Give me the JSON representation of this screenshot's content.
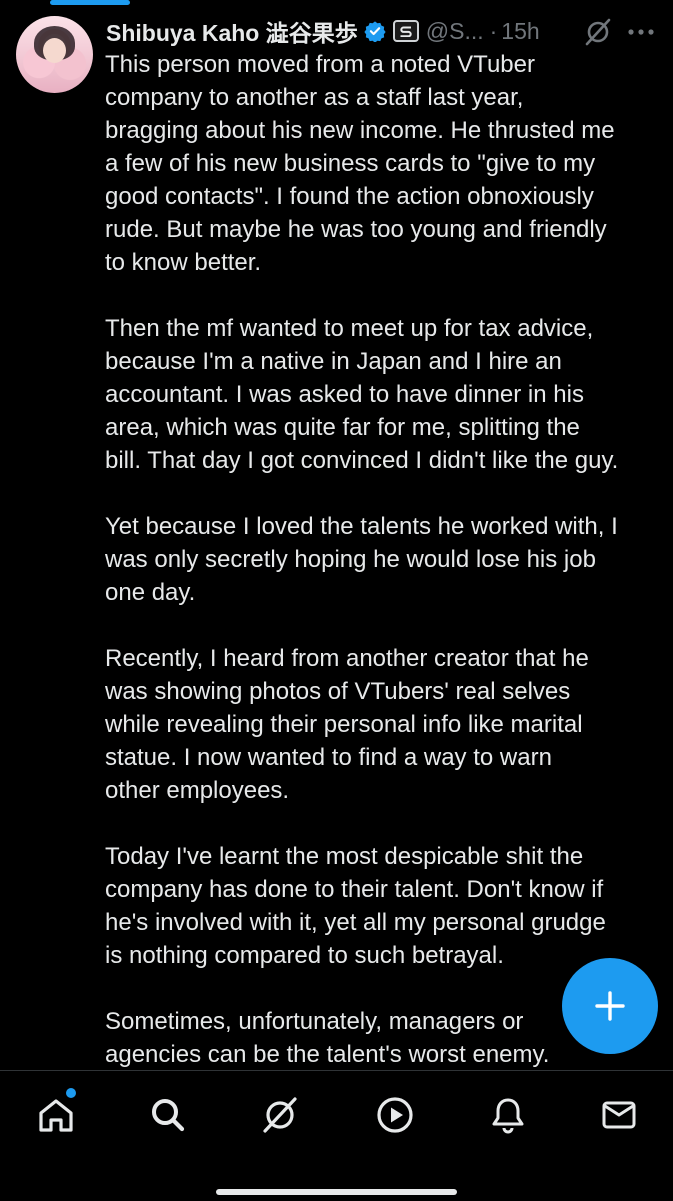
{
  "tweet": {
    "display_name": "Shibuya Kaho 澁谷果歩",
    "handle": "@S...",
    "separator": "·",
    "time": "15h",
    "paragraphs": [
      "This person moved from a noted VTuber\ncompany to another as a staff last year,\nbragging about his new income. He thrusted me\na few of his new business cards to \"give to my\ngood contacts\". I found the action obnoxiously\nrude. But maybe he was too young and friendly\nto know better.",
      "Then the mf wanted to meet up for tax advice,\nbecause I'm a native in Japan and I hire an\naccountant. I was asked to have dinner in his\narea, which was quite far for me, splitting the\nbill. That day I got convinced I didn't like the guy.",
      "Yet because I loved the talents he worked with, I\nwas only secretly hoping he would lose his job\none day.",
      "Recently, I heard from another creator that he\nwas showing photos of VTubers' real selves\nwhile revealing their personal info like marital\nstatue. I  now wanted to find a way to warn\nother employees.",
      "Today I've learnt the most despicable shit the\ncompany has done to their talent. Don't know if\nhe's involved with it, yet all my personal grudge\nis nothing compared to such betrayal.",
      "Sometimes, unfortunately, managers or\nagencies can be the talent's worst enemy."
    ]
  },
  "icons": {
    "verified": "verified-badge-icon",
    "affiliate": "affiliate-badge-icon",
    "grok": "grok-icon",
    "more": "more-icon",
    "compose": "plus-icon",
    "nav": [
      "home-icon",
      "search-icon",
      "grok-icon",
      "play-icon",
      "bell-icon",
      "mail-icon"
    ]
  },
  "colors": {
    "background": "#000000",
    "text": "#e7e9ea",
    "secondary_text": "#71767b",
    "accent": "#1d9bf0"
  }
}
